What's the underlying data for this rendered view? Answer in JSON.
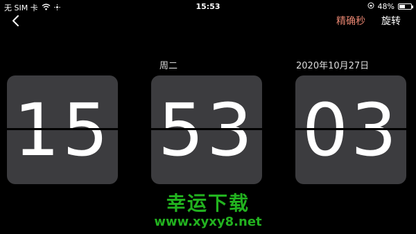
{
  "status_bar": {
    "carrier": "无 SIM 卡",
    "time": "15:53",
    "battery": "48%",
    "battery_level": 0.48
  },
  "nav": {
    "precise_seconds_label": "精确秒",
    "rotate_label": "旋转"
  },
  "clock": {
    "weekday": "周二",
    "date": "2020年10月27日",
    "hours": "15",
    "minutes": "53",
    "seconds": "03"
  },
  "watermark": {
    "title": "幸运下载",
    "url": "www.xyxy8.net"
  },
  "colors": {
    "background": "#000000",
    "card": "#3c3c3f",
    "accent": "#e88570",
    "watermark": "#22b21f"
  }
}
